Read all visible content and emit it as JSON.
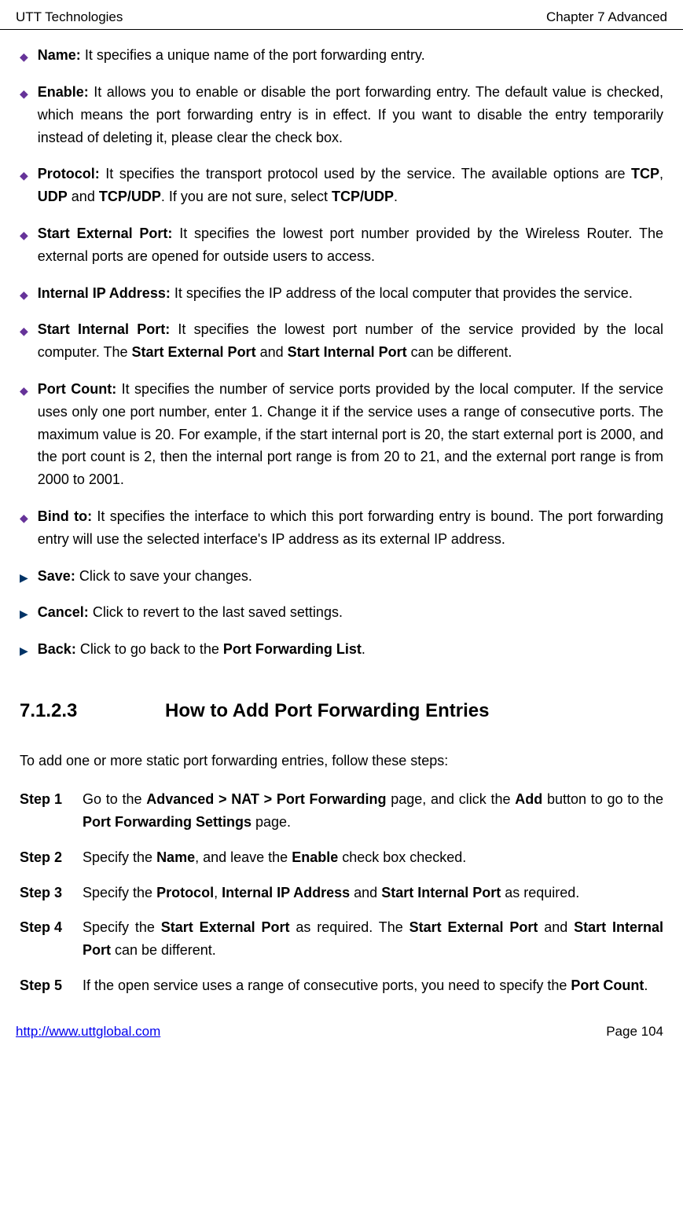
{
  "header": {
    "left": "UTT Technologies",
    "right": "Chapter 7 Advanced"
  },
  "bullets": [
    {
      "type": "diamond",
      "label": "Name:",
      "text": " It specifies a unique name of the port forwarding entry."
    },
    {
      "type": "diamond",
      "label": "Enable:",
      "text": " It allows you to enable or disable the port forwarding entry. The default value is checked, which means the port forwarding entry is in effect. If you want to disable the entry temporarily instead of deleting it, please clear the check box."
    },
    {
      "type": "diamond",
      "label": "Protocol:",
      "text": " It specifies the transport protocol used by the service. The available options are ",
      "b1": "TCP",
      "mid1": ", ",
      "b2": "UDP",
      "mid2": " and ",
      "b3": "TCP/UDP",
      "mid3": ". If you are not sure, select ",
      "b4": "TCP/UDP",
      "end": "."
    },
    {
      "type": "diamond",
      "label": "Start External Port:",
      "text": " It specifies the lowest port number provided by the Wireless Router. The external ports are opened for outside users to access."
    },
    {
      "type": "diamond",
      "label": "Internal IP Address:",
      "text": " It specifies the IP address of the local computer that provides the service."
    },
    {
      "type": "diamond",
      "label": "Start Internal Port:",
      "text": " It specifies the lowest port number of the service provided by the local computer. The ",
      "b1": "Start External Port",
      "mid1": " and ",
      "b2": "Start Internal Port",
      "end": " can be different."
    },
    {
      "type": "diamond",
      "label": "Port Count:",
      "text": " It specifies the number of service ports provided by the local computer. If the service uses only one port number, enter 1. Change it if the service uses a range of consecutive ports. The maximum value is 20. For example, if the start internal port is 20, the start external port is 2000, and the port count is 2, then the internal port range is from 20 to 21, and the external port range is from 2000 to 2001."
    },
    {
      "type": "diamond",
      "label": "Bind to:",
      "text": " It specifies the interface to which this port forwarding entry is bound. The port forwarding entry will use the selected interface's IP address as its external IP address."
    },
    {
      "type": "arrow",
      "label": "Save:",
      "text": " Click to save your changes."
    },
    {
      "type": "arrow",
      "label": "Cancel:",
      "text": " Click to revert to the last saved settings."
    },
    {
      "type": "arrow",
      "label": "Back:",
      "text": " Click to go back to the ",
      "b1": "Port Forwarding List",
      "end": "."
    }
  ],
  "section": {
    "num": "7.1.2.3",
    "title": "How to Add Port Forwarding Entries"
  },
  "intro": "To add one or more static port forwarding entries, follow these steps:",
  "steps": [
    {
      "label": "Step 1",
      "pre": "Go to the ",
      "b1": "Advanced > NAT > Port Forwarding",
      "mid1": " page, and click the ",
      "b2": "Add",
      "mid2": " button to go to the ",
      "b3": "Port Forwarding Settings",
      "end": " page."
    },
    {
      "label": "Step 2",
      "pre": "Specify the ",
      "b1": "Name",
      "mid1": ", and leave the ",
      "b2": "Enable",
      "end": " check box checked."
    },
    {
      "label": "Step 3",
      "pre": "Specify the ",
      "b1": "Protocol",
      "mid1": ", ",
      "b2": "Internal IP Address",
      "mid2": " and ",
      "b3": "Start Internal Port",
      "end": " as required."
    },
    {
      "label": "Step 4",
      "pre": "Specify the ",
      "b1": "Start External Port",
      "mid1": " as required. The ",
      "b2": "Start External Port",
      "mid2": " and ",
      "b3": "Start Internal Port",
      "end": " can be different."
    },
    {
      "label": "Step 5",
      "pre": "If the open service uses a range of consecutive ports, you need to specify the ",
      "b1": "Port Count",
      "end": "."
    }
  ],
  "footer": {
    "link": "http://www.uttglobal.com",
    "page": "Page 104"
  }
}
